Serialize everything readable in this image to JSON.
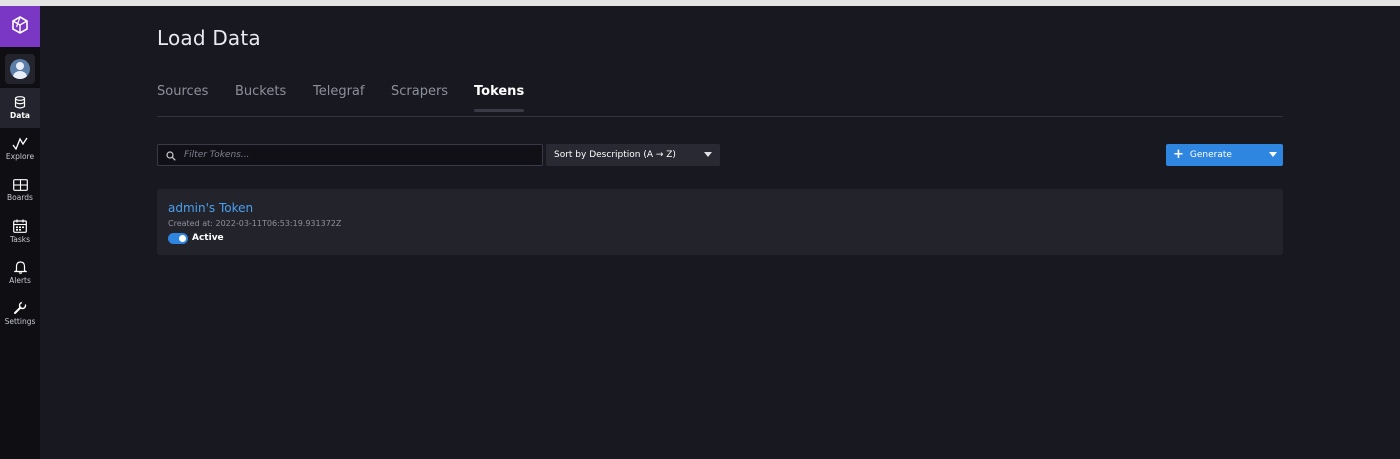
{
  "app": {
    "logo_icon": "influxdb-cubo-icon",
    "accent_color": "#7a37c4",
    "primary_color": "#2f86e0"
  },
  "sidebar": {
    "items": [
      {
        "label": "Data",
        "icon": "database-icon",
        "active": true
      },
      {
        "label": "Explore",
        "icon": "graph-icon",
        "active": false
      },
      {
        "label": "Boards",
        "icon": "dashboard-icon",
        "active": false
      },
      {
        "label": "Tasks",
        "icon": "calendar-icon",
        "active": false
      },
      {
        "label": "Alerts",
        "icon": "bell-icon",
        "active": false
      },
      {
        "label": "Settings",
        "icon": "wrench-icon",
        "active": false
      }
    ]
  },
  "page": {
    "title": "Load Data"
  },
  "tabs": [
    {
      "label": "Sources",
      "active": false
    },
    {
      "label": "Buckets",
      "active": false
    },
    {
      "label": "Telegraf",
      "active": false
    },
    {
      "label": "Scrapers",
      "active": false
    },
    {
      "label": "Tokens",
      "active": true
    }
  ],
  "filter": {
    "placeholder": "Filter Tokens...",
    "value": ""
  },
  "sort": {
    "label": "Sort by Description (A → Z)"
  },
  "generate": {
    "label": "Generate"
  },
  "tokens": [
    {
      "name": "admin's Token",
      "created": "Created at: 2022-03-11T06:53:19.931372Z",
      "status": "Active",
      "enabled": true
    }
  ]
}
